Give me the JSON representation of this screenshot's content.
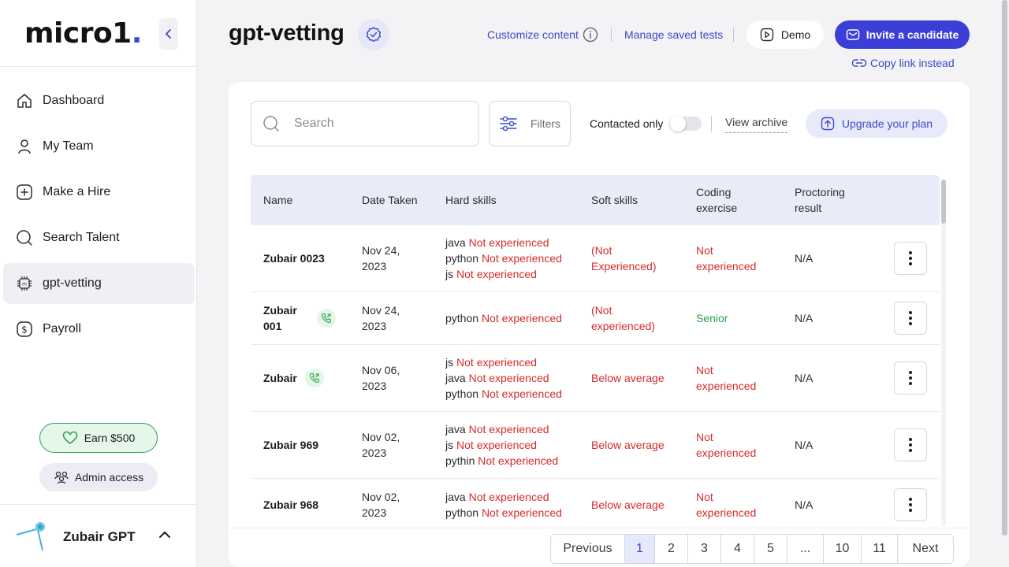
{
  "sidebar": {
    "logo": "micro1",
    "logo_dot": ".",
    "items": [
      {
        "label": "Dashboard",
        "icon": "home-icon"
      },
      {
        "label": "My Team",
        "icon": "person-icon"
      },
      {
        "label": "Make a Hire",
        "icon": "plus-square-icon"
      },
      {
        "label": "Search Talent",
        "icon": "search-icon"
      },
      {
        "label": "gpt-vetting",
        "icon": "chip-icon",
        "active": true
      },
      {
        "label": "Payroll",
        "icon": "dollar-icon"
      }
    ],
    "earn_label": "Earn $500",
    "admin_label": "Admin access",
    "user_name": "Zubair GPT"
  },
  "header": {
    "title": "gpt-vetting",
    "customize_label": "Customize content",
    "manage_label": "Manage saved tests",
    "demo_label": "Demo",
    "invite_label": "Invite a candidate",
    "copy_link_label": "Copy link instead"
  },
  "toolbar": {
    "search_placeholder": "Search",
    "filters_label": "Filters",
    "contacted_label": "Contacted only",
    "contacted_on": false,
    "archive_label": "View archive",
    "upgrade_label": "Upgrade your plan"
  },
  "table": {
    "headers": {
      "name": "Name",
      "date": "Date Taken",
      "hard": "Hard skills",
      "soft": "Soft skills",
      "coding_l1": "Coding",
      "coding_l2": "exercise",
      "proct_l1": "Proctoring",
      "proct_l2": "result"
    },
    "rows": [
      {
        "name_l1": "Zubair 0023",
        "name_l2": "",
        "contacted": false,
        "date_l1": "Nov 24,",
        "date_l2": "2023",
        "hard": [
          {
            "skill": "java",
            "level": "Not experienced"
          },
          {
            "skill": "python",
            "level": "Not experienced"
          },
          {
            "skill": "js",
            "level": "Not experienced"
          }
        ],
        "soft_l1": "(Not",
        "soft_l2": "Experienced)",
        "coding_l1": "Not",
        "coding_l2": "experienced",
        "coding_color": "#d52b2b",
        "proctoring": "N/A"
      },
      {
        "name_l1": "Zubair",
        "name_l2": "001",
        "contacted": true,
        "date_l1": "Nov 24,",
        "date_l2": "2023",
        "hard": [
          {
            "skill": "python",
            "level": "Not experienced"
          }
        ],
        "soft_l1": "(Not",
        "soft_l2": "experienced)",
        "coding_l1": "Senior",
        "coding_l2": "",
        "coding_color": "#2aa04a",
        "proctoring": "N/A"
      },
      {
        "name_l1": "Zubair",
        "name_l2": "",
        "contacted": true,
        "date_l1": "Nov 06,",
        "date_l2": "2023",
        "hard": [
          {
            "skill": "js",
            "level": "Not experienced"
          },
          {
            "skill": "java",
            "level": "Not experienced"
          },
          {
            "skill": "python",
            "level": "Not experienced"
          }
        ],
        "soft_l1": "Below average",
        "soft_l2": "",
        "coding_l1": "Not",
        "coding_l2": "experienced",
        "coding_color": "#d52b2b",
        "proctoring": "N/A"
      },
      {
        "name_l1": "Zubair 969",
        "name_l2": "",
        "contacted": false,
        "date_l1": "Nov 02,",
        "date_l2": "2023",
        "hard": [
          {
            "skill": "java",
            "level": "Not experienced"
          },
          {
            "skill": "js",
            "level": "Not experienced"
          },
          {
            "skill": "pythin",
            "level": "Not experienced"
          }
        ],
        "soft_l1": "Below average",
        "soft_l2": "",
        "coding_l1": "Not",
        "coding_l2": "experienced",
        "coding_color": "#d52b2b",
        "proctoring": "N/A"
      },
      {
        "name_l1": "Zubair 968",
        "name_l2": "",
        "contacted": false,
        "date_l1": "Nov 02,",
        "date_l2": "2023",
        "hard": [
          {
            "skill": "java",
            "level": "Not experienced"
          },
          {
            "skill": "python",
            "level": "Not experienced"
          }
        ],
        "soft_l1": "Below average",
        "soft_l2": "",
        "coding_l1": "Not",
        "coding_l2": "experienced",
        "coding_color": "#d52b2b",
        "proctoring": "N/A"
      }
    ]
  },
  "pagination": {
    "items": [
      "Previous",
      "1",
      "2",
      "3",
      "4",
      "5",
      "...",
      "10",
      "11",
      "Next"
    ],
    "active": "1"
  },
  "colors": {
    "accent": "#3b3fd8",
    "link": "#3b4bc8",
    "danger": "#d52b2b",
    "success": "#2aa04a"
  }
}
